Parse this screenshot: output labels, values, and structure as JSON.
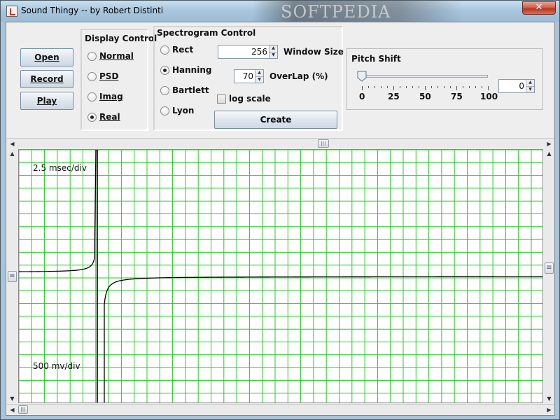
{
  "window": {
    "title": "Sound Thingy -- by Robert Distinti",
    "close_label": "✕",
    "watermark": "SOFTPEDIA"
  },
  "buttons": {
    "open": "Open",
    "record": "Record",
    "play": "Play"
  },
  "display_control": {
    "title": "Display Control",
    "options": [
      "Normal",
      "PSD",
      "Imag",
      "Real"
    ],
    "selected": "Real"
  },
  "spectrogram_control": {
    "title": "Spectrogram Control",
    "windows": [
      "Rect",
      "Hanning",
      "Bartlett",
      "Lyon"
    ],
    "selected_window": "Hanning",
    "window_size_value": "256",
    "window_size_label": "Window Size",
    "overlap_value": "70",
    "overlap_label": "OverLap (%)",
    "log_scale_label": "log scale",
    "log_scale_checked": false,
    "create_label": "Create"
  },
  "pitch_shift": {
    "title": "Pitch Shift",
    "tick_labels": [
      "0",
      "25",
      "50",
      "75",
      "100"
    ],
    "slider_value": 0,
    "spinner_value": "0"
  },
  "plot": {
    "time_scale_label": "2.5 msec/div",
    "amp_scale_label": "500 mv/div",
    "grid_color": "#22cc22",
    "trace_color": "#000000"
  },
  "icons": {
    "scroll_left": "◀",
    "scroll_right": "▶",
    "scroll_up": "▲",
    "scroll_down": "▼",
    "grip": "|||",
    "grip_v": "≡"
  }
}
